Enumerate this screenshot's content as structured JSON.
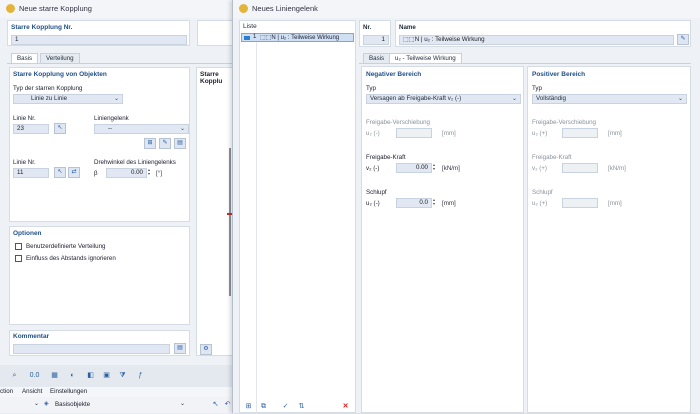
{
  "back_window": {
    "title": "Neue starre Kopplung",
    "no_label": "Starre Kopplung Nr.",
    "no_value": "1",
    "tabs": [
      "Basis",
      "Verteilung"
    ],
    "section_title": "Starre Kopplung von Objekten",
    "type_label": "Typ der starren Kopplung",
    "type_value": "Linie zu Linie",
    "line1_label": "Linie Nr.",
    "line1_value": "23",
    "hinge_label": "Liniengelenk",
    "hinge_value": "--",
    "line2_label": "Linie Nr.",
    "line2_value": "11",
    "rotation_label": "Drehwinkel des Liniengelenks",
    "rotation_symbol": "β",
    "rotation_value": "0.00",
    "rotation_unit": "[°]",
    "options_title": "Optionen",
    "options": [
      "Benutzerdefinierte Verteilung",
      "Einfluss des Abstands ignorieren"
    ],
    "comment_title": "Kommentar",
    "preview_title": "Starre Kopplu",
    "menu_items": [
      "ction",
      "Ansicht",
      "Einstellungen"
    ],
    "basis_objects": "Basisobjekte"
  },
  "front_window": {
    "title": "Neues Liniengelenk",
    "list_header": "Liste",
    "list_items": [
      {
        "no": "1",
        "text": "⬚⬚N | u₂ : Teilweise Wirkung"
      }
    ],
    "nr_label": "Nr.",
    "nr_value": "1",
    "name_label": "Name",
    "name_value": "⬚⬚N | u₂ : Teilweise Wirkung",
    "tabs": [
      "Basis",
      "u₂ - Teilweise Wirkung"
    ],
    "negative": {
      "title": "Negativer Bereich",
      "typ_label": "Typ",
      "typ_value": "Versagen ab Freigabe-Kraft v₂ (-)",
      "shift_title": "Freigabe-Verschiebung",
      "shift_label": "u₂ (-)",
      "shift_unit": "[mm]",
      "force_title": "Freigabe-Kraft",
      "force_label": "v₂ (-)",
      "force_value": "0.00",
      "force_unit": "[kN/m]",
      "slip_title": "Schlupf",
      "slip_label": "u₂ (-)",
      "slip_value": "0.0",
      "slip_unit": "[mm]"
    },
    "positive": {
      "title": "Positiver Bereich",
      "typ_label": "Typ",
      "typ_value": "Vollständig",
      "shift_title": "Freigabe-Verschiebung",
      "shift_label": "u₂ (+)",
      "shift_unit": "[mm]",
      "force_title": "Freigabe-Kraft",
      "force_label": "v₂ (+)",
      "force_unit": "[kN/m]",
      "slip_title": "Schlupf",
      "slip_label": "u₂ (+)",
      "slip_unit": "[mm]"
    }
  }
}
